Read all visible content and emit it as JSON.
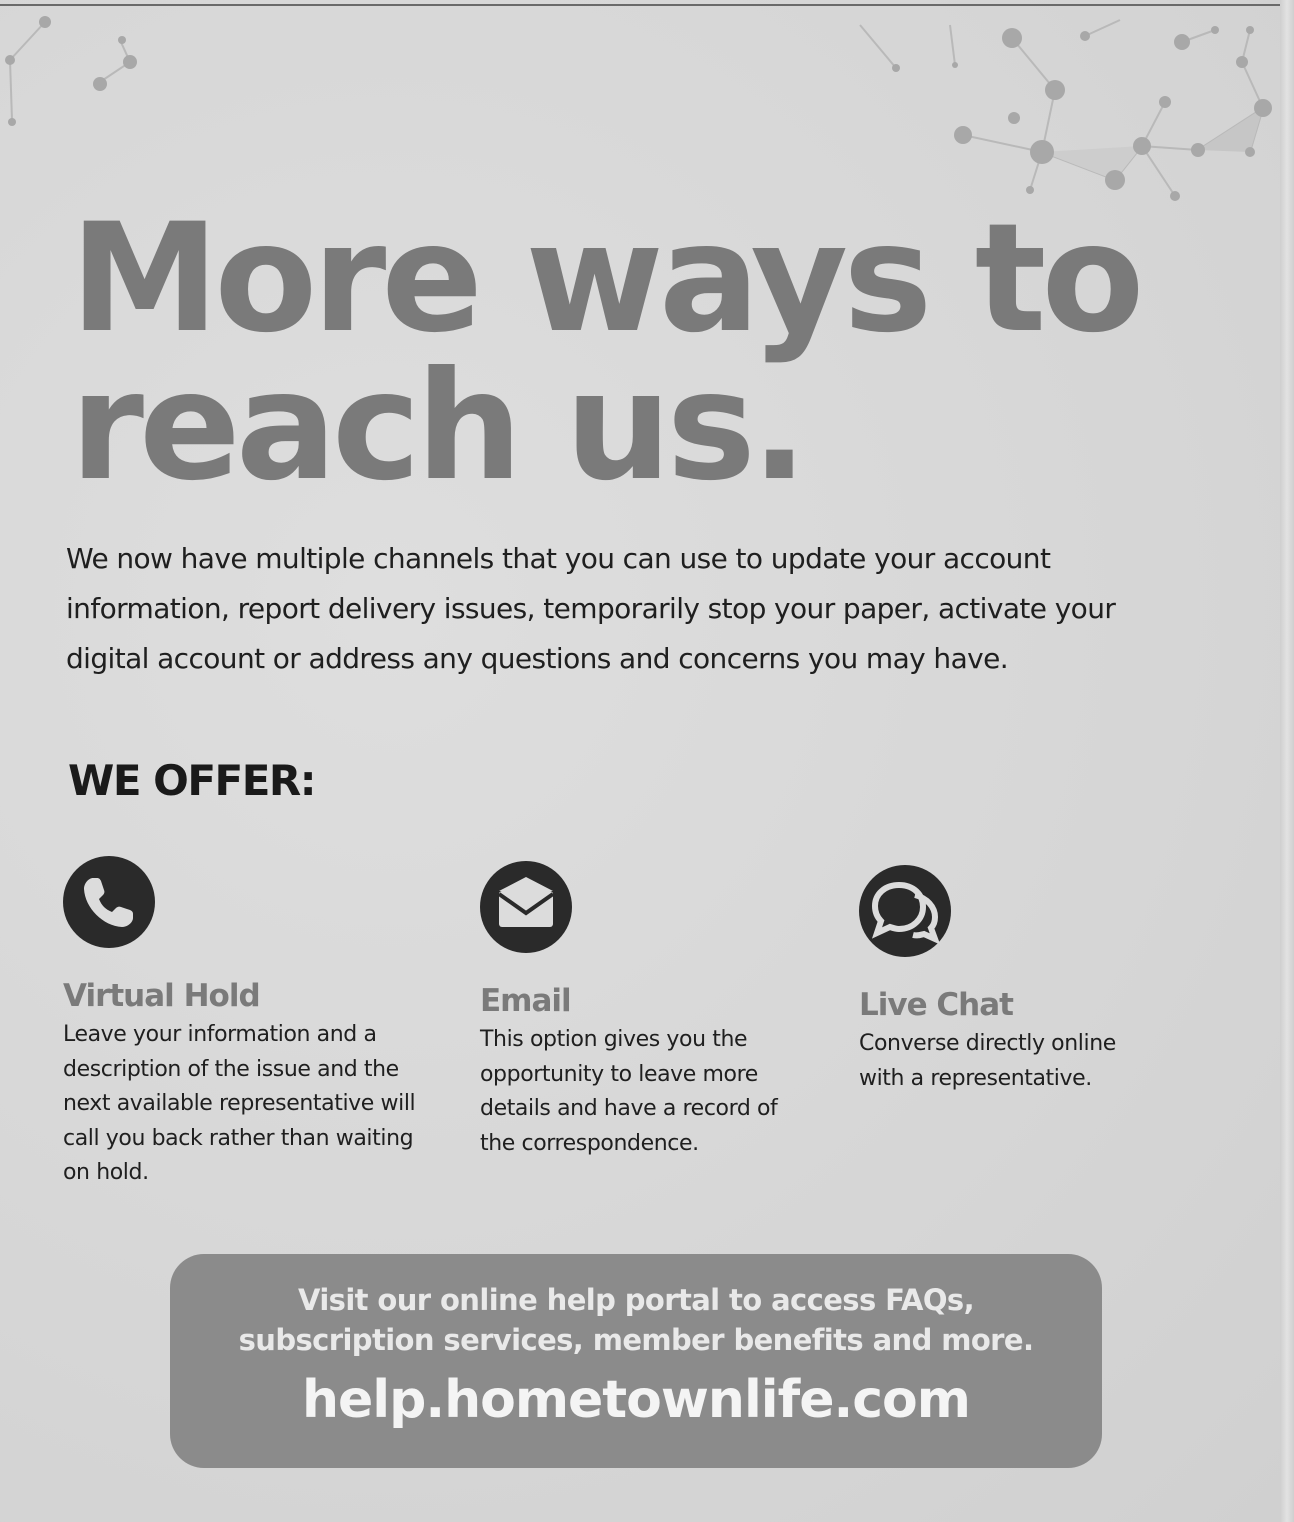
{
  "headline": {
    "line1": "More ways to",
    "line2": "reach us."
  },
  "intro": "We now have multiple channels that you can use to update your account information, report delivery issues, temporarily stop your paper, activate your digital account or address any questions and concerns you may have.",
  "offer_heading": "WE OFFER:",
  "options": [
    {
      "icon": "phone-icon",
      "title": "Virtual Hold",
      "description": "Leave your information and a description of the issue and the next available representative will call you back rather than waiting on hold."
    },
    {
      "icon": "envelope-icon",
      "title": "Email",
      "description": "This option gives you the opportunity to leave more details and have a record of the correspondence."
    },
    {
      "icon": "chat-icon",
      "title": "Live Chat",
      "description": "Converse directly online with a representative."
    }
  ],
  "portal": {
    "line1": "Visit our online help portal to access FAQs,",
    "line2": "subscription services, member benefits and more.",
    "url": "help.hometownlife.com"
  },
  "colors": {
    "headline": "#7a7a7a",
    "text": "#1f1f1f",
    "icon_fill": "#2a2a2a",
    "portal_bg": "#8b8b8b"
  }
}
